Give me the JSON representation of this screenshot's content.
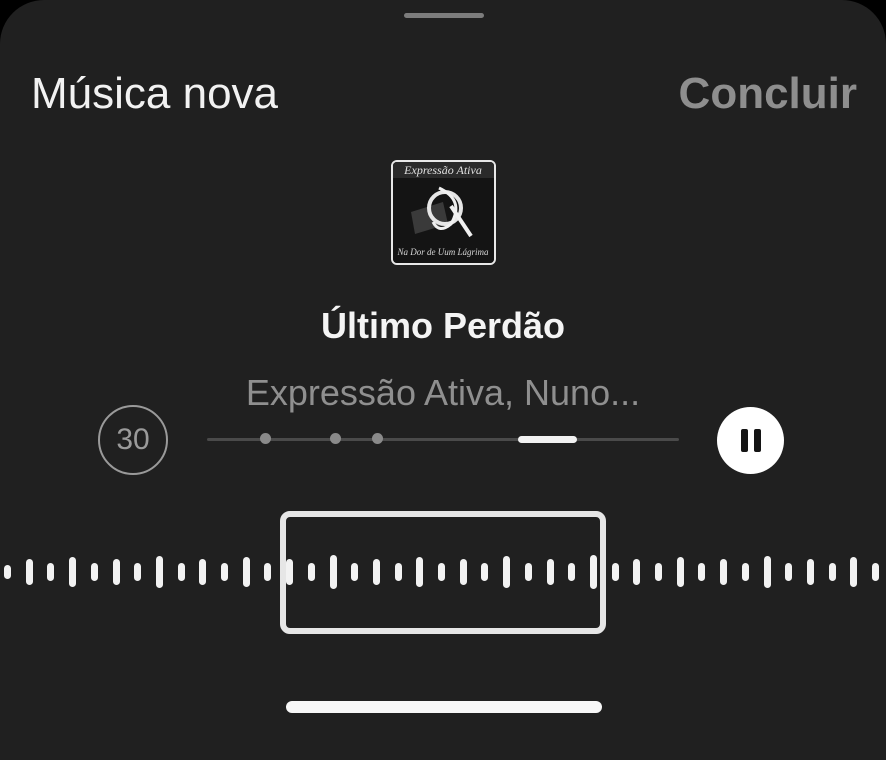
{
  "header": {
    "title": "Música nova",
    "done_label": "Concluir"
  },
  "album": {
    "cover_top_text": "Expressão Ativa",
    "cover_bottom_text": "Na Dor de Uum Lágrima"
  },
  "track": {
    "title": "Último Perdão",
    "artist": "Expressão Ativa, Nuno..."
  },
  "controls": {
    "skip_label": "30",
    "pause_icon": "pause-icon"
  },
  "colors": {
    "background": "#202020",
    "text_primary": "#f2f2f2",
    "text_secondary": "#8f8f8f"
  }
}
